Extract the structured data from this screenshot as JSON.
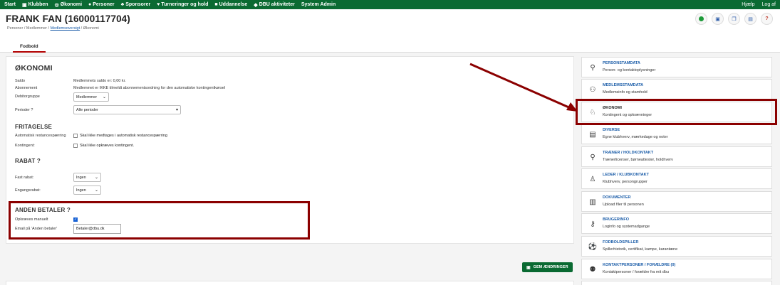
{
  "topnav": {
    "items": [
      {
        "icon": "home",
        "label": "Start"
      },
      {
        "icon": "building-icon",
        "label": "Klubben"
      },
      {
        "icon": "coin-icon",
        "label": "Økonomi"
      },
      {
        "icon": "person-icon",
        "label": "Personer"
      },
      {
        "icon": "sponsor-icon",
        "label": "Sponsorer"
      },
      {
        "icon": "trophy-icon",
        "label": "Turneringer og hold"
      },
      {
        "icon": "graduation-icon",
        "label": "Uddannelse"
      },
      {
        "icon": "dbu-icon",
        "label": "DBU aktiviteter"
      },
      {
        "icon": "",
        "label": "System Admin"
      }
    ],
    "right": [
      "Hjælp",
      "Log af"
    ]
  },
  "header": {
    "title": "FRANK FAN (16000117704)",
    "breadcrumb": {
      "a": "Personer",
      "b": "Medlemmer",
      "link": "Medlemsoversigt",
      "c": "Økonomi"
    },
    "icons": [
      "green-circle-icon",
      "save-icon",
      "copy-icon",
      "document-icon",
      "help-icon"
    ]
  },
  "tabs": {
    "active": "Fodbold"
  },
  "okonomi": {
    "heading": "ØKONOMI",
    "saldo_label": "Saldo",
    "saldo_value": "Medlemmets saldo er: 0,00 kr.",
    "abonnement_label": "Abonnement",
    "abonnement_value": "Medlemmet er IKKE tilmeldt abonnementsordning for den automatiske kontingentkørsel",
    "debitorgruppe_label": "Debitorgruppe",
    "debitorgruppe_value": "Medlemmer",
    "perioder_label": "Perioder",
    "perioder_value": "Alle perioder"
  },
  "fritagelse": {
    "heading": "FRITAGELSE",
    "restance_label": "Automatisk restancespærring",
    "restance_text": "Skal ikke medtages i automatisk restancespærring",
    "kontingent_label": "Kontingent:",
    "kontingent_text": "Skal ikke opkræves kontingent."
  },
  "rabat": {
    "heading": "RABAT",
    "fast_label": "Fast rabat:",
    "fast_value": "Ingen",
    "engangs_label": "Engangsrabat:",
    "engangs_value": "Ingen"
  },
  "anden": {
    "heading": "ANDEN BETALER",
    "opkraeves_label": "Opkræves manuelt",
    "opkraeves_checked": true,
    "email_label": "Email på 'Anden betaler'",
    "email_value": "Betaler@dbu.dk"
  },
  "save_label": "GEM ÆNDRINGER",
  "sidebar": [
    {
      "title": "PERSONSTAMDATA",
      "sub": "Person- og kontaktoplysninger",
      "icon": "person-icon"
    },
    {
      "title": "MEDLEMSSTAMDATA",
      "sub": "Medlemsinfo og stamhold",
      "icon": "group-icon"
    },
    {
      "title": "ØKONOMI",
      "sub": "Kontingent og opkrævninger",
      "icon": "piggy-bank-icon"
    },
    {
      "title": "DIVERSE",
      "sub": "Egne klubhverv, mærkedage og noter",
      "icon": "archive-icon"
    },
    {
      "title": "TRÆNER / HOLDKONTAKT",
      "sub": "Trænerlicenser, børneattester, holdhverv",
      "icon": "coach-icon"
    },
    {
      "title": "LEDER / KLUBKONTAKT",
      "sub": "Klubhverv, persongrupper",
      "icon": "leader-icon"
    },
    {
      "title": "DOKUMENTER",
      "sub": "Upload filer til personen",
      "icon": "documents-icon"
    },
    {
      "title": "BRUGERINFO",
      "sub": "Loginfo og systemadgange",
      "icon": "key-icon"
    },
    {
      "title": "FODBOLDSPILLER",
      "sub": "Spillerhistorik, certifikat, kampe, karantæne",
      "icon": "player-icon"
    },
    {
      "title": "KONTAKTPERSONER / FORÆLDRE (0)",
      "sub": "Kontaktpersoner / forældre fra mit dbu",
      "icon": "family-icon"
    }
  ],
  "colors": {
    "nav": "#0a6a32",
    "highlight": "#8b0000",
    "link": "#1a5ca8"
  }
}
